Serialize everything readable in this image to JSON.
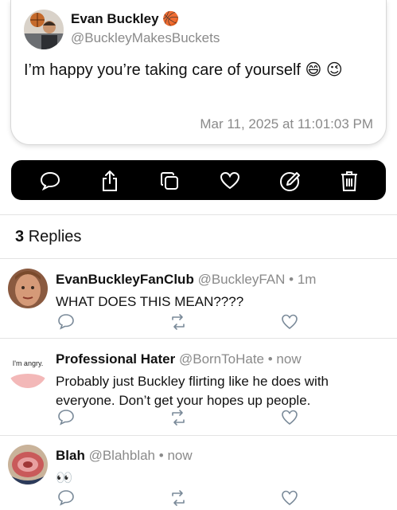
{
  "post": {
    "author_name": "Evan Buckley",
    "author_emoji": "🏀",
    "author_handle": "@BuckleyMakesBuckets",
    "text": "I’m happy you’re taking care of yourself 😄 😉",
    "timestamp": "Mar 11, 2025 at 11:01:03 PM"
  },
  "toolbar": {
    "icons": [
      "comment-icon",
      "share-icon",
      "copy-icon",
      "heart-icon",
      "edit-icon",
      "trash-icon"
    ]
  },
  "replies": {
    "count": "3",
    "label": "Replies",
    "items": [
      {
        "name": "EvanBuckleyFanClub",
        "handle": "@BuckleyFAN",
        "sep": "•",
        "time": "1m",
        "text": "WHAT DOES THIS MEAN????"
      },
      {
        "name": "Professional Hater",
        "handle": "@BornToHate",
        "sep": "•",
        "time": "now",
        "text": "Probably just Buckley flirting like he does with everyone. Don’t get your hopes up people.",
        "avatar_text": "I'm angry."
      },
      {
        "name": "Blah",
        "handle": "@Blahblah",
        "sep": "•",
        "time": "now",
        "text": "👀"
      }
    ]
  }
}
